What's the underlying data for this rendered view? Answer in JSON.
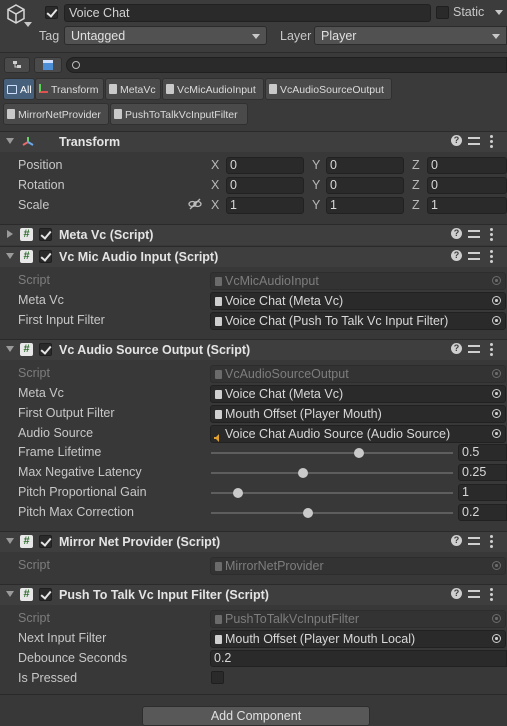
{
  "gameobject": {
    "name": "Voice Chat",
    "active": true,
    "static_label": "Static",
    "static_checked": false,
    "tag_label": "Tag",
    "tag_value": "Untagged",
    "layer_label": "Layer",
    "layer_value": "Player"
  },
  "search": {
    "value": ""
  },
  "chips": [
    {
      "label": "All",
      "active": true
    },
    {
      "label": "Transform",
      "active": false
    },
    {
      "label": "MetaVc",
      "active": false
    },
    {
      "label": "VcMicAudioInput",
      "active": false
    },
    {
      "label": "VcAudioSourceOutput",
      "active": false
    },
    {
      "label": "MirrorNetProvider",
      "active": false
    },
    {
      "label": "PushToTalkVcInputFilter",
      "active": false
    }
  ],
  "transform": {
    "title": "Transform",
    "rows": [
      {
        "label": "Position",
        "x": "0",
        "y": "0",
        "z": "0"
      },
      {
        "label": "Rotation",
        "x": "0",
        "y": "0",
        "z": "0"
      },
      {
        "label": "Scale",
        "x": "1",
        "y": "1",
        "z": "1"
      }
    ],
    "axis_x": "X",
    "axis_y": "Y",
    "axis_z": "Z"
  },
  "meta_vc": {
    "title": "Meta Vc (Script)",
    "expanded": false,
    "enabled": true
  },
  "mic_input": {
    "title": "Vc Mic Audio Input (Script)",
    "enabled": true,
    "script_label": "Script",
    "script_value": "VcMicAudioInput",
    "meta_vc_label": "Meta Vc",
    "meta_vc_value": "Voice Chat (Meta Vc)",
    "first_filter_label": "First Input Filter",
    "first_filter_value": "Voice Chat (Push To Talk Vc Input Filter)"
  },
  "source_output": {
    "title": "Vc Audio Source Output (Script)",
    "enabled": true,
    "script_label": "Script",
    "script_value": "VcAudioSourceOutput",
    "meta_vc_label": "Meta Vc",
    "meta_vc_value": "Voice Chat (Meta Vc)",
    "first_filter_label": "First Output Filter",
    "first_filter_value": "Mouth Offset (Player Mouth)",
    "audio_source_label": "Audio Source",
    "audio_source_value": "Voice Chat Audio Source (Audio Source)",
    "sliders": [
      {
        "label": "Frame Lifetime",
        "value": "0.5",
        "fraction": 0.61
      },
      {
        "label": "Max Negative Latency",
        "value": "0.25",
        "fraction": 0.38
      },
      {
        "label": "Pitch Proportional Gain",
        "value": "1",
        "fraction": 0.11
      },
      {
        "label": "Pitch Max Correction",
        "value": "0.2",
        "fraction": 0.4
      }
    ]
  },
  "mirror": {
    "title": "Mirror Net Provider (Script)",
    "enabled": true,
    "script_label": "Script",
    "script_value": "MirrorNetProvider"
  },
  "ptt": {
    "title": "Push To Talk Vc Input Filter (Script)",
    "enabled": true,
    "script_label": "Script",
    "script_value": "PushToTalkVcInputFilter",
    "next_filter_label": "Next Input Filter",
    "next_filter_value": "Mouth Offset (Player Mouth Local)",
    "debounce_label": "Debounce Seconds",
    "debounce_value": "0.2",
    "pressed_label": "Is Pressed",
    "pressed_checked": false
  },
  "add_component_label": "Add Component",
  "colors": {
    "background": "#383838",
    "field": "#2a2a2a",
    "chip_active": "#46607c",
    "script_icon": "#2f6b2f"
  }
}
